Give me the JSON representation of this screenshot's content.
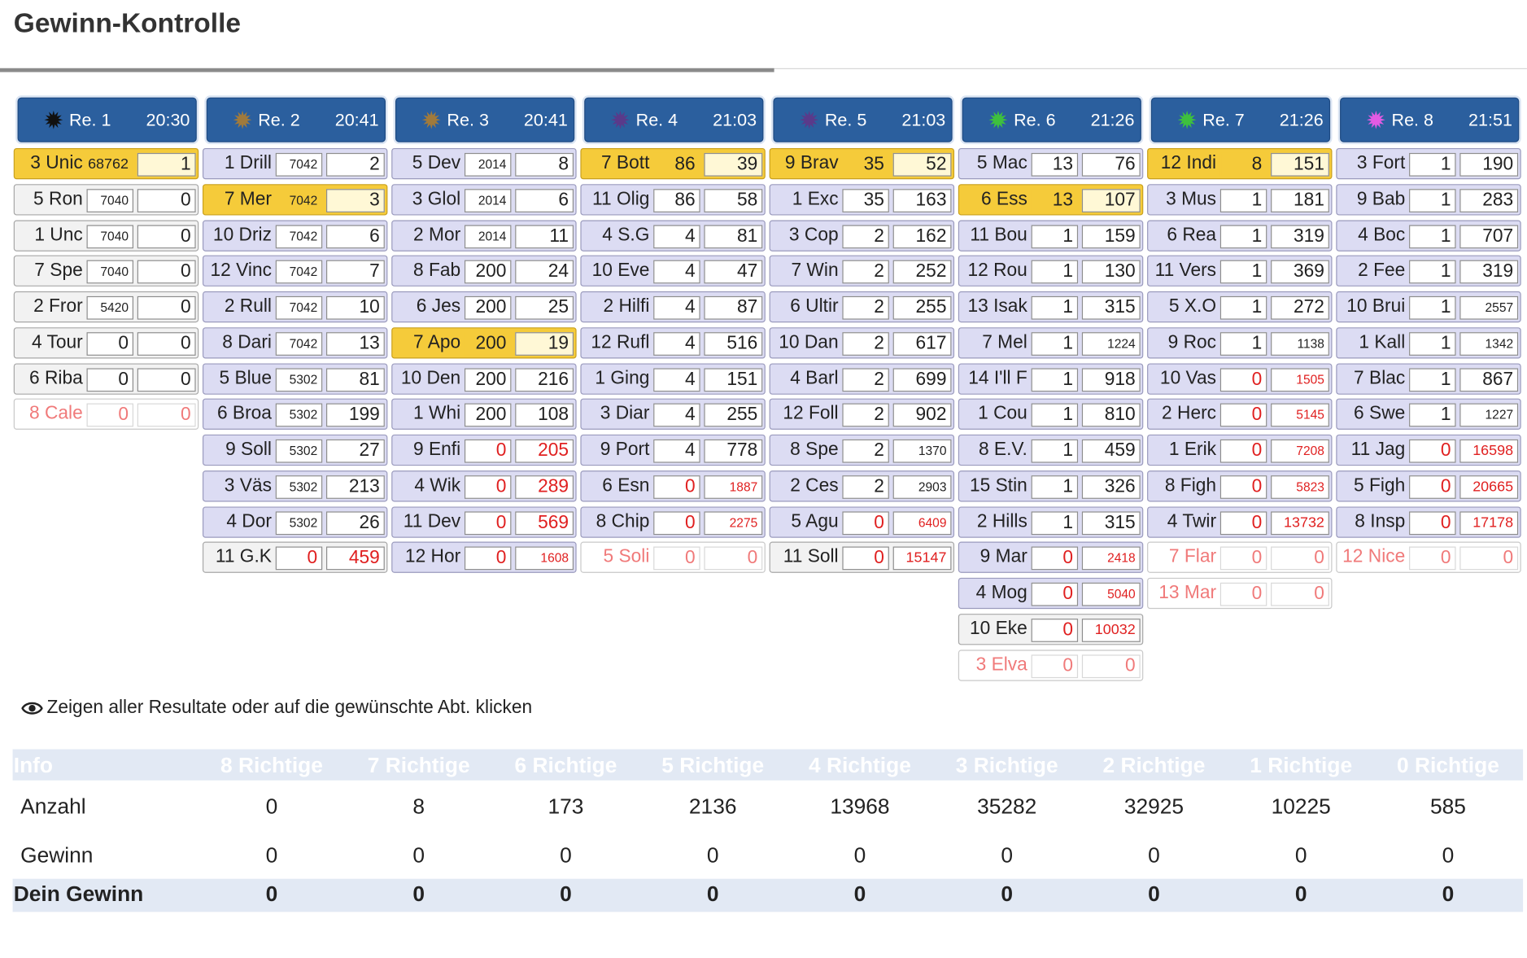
{
  "page": {
    "title": "Gewinn-Kontrolle"
  },
  "races": [
    {
      "name": "Re. 1",
      "time": "20:30",
      "star_color": "#111111",
      "rows": [
        {
          "label": "3 Unic",
          "v1": "68762",
          "v2": "1",
          "state": "sel"
        },
        {
          "label": "5 Ron",
          "v1": "7040",
          "v2": "0",
          "state": "plain"
        },
        {
          "label": "1 Unc",
          "v1": "7040",
          "v2": "0",
          "state": "plain"
        },
        {
          "label": "7 Spe",
          "v1": "7040",
          "v2": "0",
          "state": "plain"
        },
        {
          "label": "2 Fror",
          "v1": "5420",
          "v2": "0",
          "state": "plain"
        },
        {
          "label": "4 Tour",
          "v1": "0",
          "v2": "0",
          "state": "plain"
        },
        {
          "label": "6 Riba",
          "v1": "0",
          "v2": "0",
          "state": "plain"
        },
        {
          "label": "8 Cale",
          "v1": "0",
          "v2": "0",
          "state": "scr"
        }
      ]
    },
    {
      "name": "Re. 2",
      "time": "20:41",
      "star_color": "#a07a3c",
      "rows": [
        {
          "label": "1 Drill",
          "v1": "7042",
          "v2": "2",
          "state": "normal"
        },
        {
          "label": "7 Mer",
          "v1": "7042",
          "v2": "3",
          "state": "sel"
        },
        {
          "label": "10 Driz",
          "v1": "7042",
          "v2": "6",
          "state": "normal"
        },
        {
          "label": "12 Vinc",
          "v1": "7042",
          "v2": "7",
          "state": "normal"
        },
        {
          "label": "2 Rull",
          "v1": "7042",
          "v2": "10",
          "state": "normal"
        },
        {
          "label": "8 Dari",
          "v1": "7042",
          "v2": "13",
          "state": "normal"
        },
        {
          "label": "5 Blue",
          "v1": "5302",
          "v2": "81",
          "state": "normal"
        },
        {
          "label": "6 Broa",
          "v1": "5302",
          "v2": "199",
          "state": "normal"
        },
        {
          "label": "9 Soll",
          "v1": "5302",
          "v2": "27",
          "state": "normal"
        },
        {
          "label": "3 Väs",
          "v1": "5302",
          "v2": "213",
          "state": "normal"
        },
        {
          "label": "4 Dor",
          "v1": "5302",
          "v2": "26",
          "state": "normal"
        },
        {
          "label": "11 G.K",
          "v1": "0",
          "v2": "459",
          "state": "plain",
          "red": true
        }
      ]
    },
    {
      "name": "Re. 3",
      "time": "20:41",
      "star_color": "#a07a3c",
      "rows": [
        {
          "label": "5 Dev",
          "v1": "2014",
          "v2": "8",
          "state": "normal"
        },
        {
          "label": "3 Glol",
          "v1": "2014",
          "v2": "6",
          "state": "normal"
        },
        {
          "label": "2 Mor",
          "v1": "2014",
          "v2": "11",
          "state": "normal"
        },
        {
          "label": "8 Fab",
          "v1": "200",
          "v2": "24",
          "state": "normal"
        },
        {
          "label": "6 Jes",
          "v1": "200",
          "v2": "25",
          "state": "normal"
        },
        {
          "label": "7 Apo",
          "v1": "200",
          "v2": "19",
          "state": "sel"
        },
        {
          "label": "10 Den",
          "v1": "200",
          "v2": "216",
          "state": "normal"
        },
        {
          "label": "1 Whi",
          "v1": "200",
          "v2": "108",
          "state": "normal"
        },
        {
          "label": "9 Enfi",
          "v1": "0",
          "v2": "205",
          "state": "normal",
          "red": true
        },
        {
          "label": "4 Wik",
          "v1": "0",
          "v2": "289",
          "state": "normal",
          "red": true
        },
        {
          "label": "11 Dev",
          "v1": "0",
          "v2": "569",
          "state": "normal",
          "red": true
        },
        {
          "label": "12 Hor",
          "v1": "0",
          "v2": "1608",
          "state": "normal",
          "red": true
        }
      ]
    },
    {
      "name": "Re. 4",
      "time": "21:03",
      "star_color": "#5a3a8a",
      "rows": [
        {
          "label": "7 Bott",
          "v1": "86",
          "v2": "39",
          "state": "sel"
        },
        {
          "label": "11 Olig",
          "v1": "86",
          "v2": "58",
          "state": "normal"
        },
        {
          "label": "4 S.G",
          "v1": "4",
          "v2": "81",
          "state": "normal"
        },
        {
          "label": "10 Eve",
          "v1": "4",
          "v2": "47",
          "state": "normal"
        },
        {
          "label": "2 Hilfi",
          "v1": "4",
          "v2": "87",
          "state": "normal"
        },
        {
          "label": "12 Rufl",
          "v1": "4",
          "v2": "516",
          "state": "normal"
        },
        {
          "label": "1 Ging",
          "v1": "4",
          "v2": "151",
          "state": "normal"
        },
        {
          "label": "3 Diar",
          "v1": "4",
          "v2": "255",
          "state": "normal"
        },
        {
          "label": "9 Port",
          "v1": "4",
          "v2": "778",
          "state": "normal"
        },
        {
          "label": "6 Esn",
          "v1": "0",
          "v2": "1887",
          "state": "normal",
          "red": true
        },
        {
          "label": "8 Chip",
          "v1": "0",
          "v2": "2275",
          "state": "normal",
          "red": true
        },
        {
          "label": "5 Soli",
          "v1": "0",
          "v2": "0",
          "state": "scr"
        }
      ]
    },
    {
      "name": "Re. 5",
      "time": "21:03",
      "star_color": "#5a3a8a",
      "rows": [
        {
          "label": "9 Brav",
          "v1": "35",
          "v2": "52",
          "state": "sel"
        },
        {
          "label": "1 Exc",
          "v1": "35",
          "v2": "163",
          "state": "normal"
        },
        {
          "label": "3 Cop",
          "v1": "2",
          "v2": "162",
          "state": "normal"
        },
        {
          "label": "7 Win",
          "v1": "2",
          "v2": "252",
          "state": "normal"
        },
        {
          "label": "6 Ultir",
          "v1": "2",
          "v2": "255",
          "state": "normal"
        },
        {
          "label": "10 Dan",
          "v1": "2",
          "v2": "617",
          "state": "normal"
        },
        {
          "label": "4 Barl",
          "v1": "2",
          "v2": "699",
          "state": "normal"
        },
        {
          "label": "12 Foll",
          "v1": "2",
          "v2": "902",
          "state": "normal"
        },
        {
          "label": "8 Spe",
          "v1": "2",
          "v2": "1370",
          "state": "normal"
        },
        {
          "label": "2 Ces",
          "v1": "2",
          "v2": "2903",
          "state": "normal"
        },
        {
          "label": "5 Agu",
          "v1": "0",
          "v2": "6409",
          "state": "normal",
          "red": true
        },
        {
          "label": "11 Soll",
          "v1": "0",
          "v2": "15147",
          "state": "plain",
          "red": true
        }
      ]
    },
    {
      "name": "Re. 6",
      "time": "21:26",
      "star_color": "#3ec03e",
      "rows": [
        {
          "label": "5 Mac",
          "v1": "13",
          "v2": "76",
          "state": "normal"
        },
        {
          "label": "6 Ess",
          "v1": "13",
          "v2": "107",
          "state": "sel"
        },
        {
          "label": "11 Bou",
          "v1": "1",
          "v2": "159",
          "state": "normal"
        },
        {
          "label": "12 Rou",
          "v1": "1",
          "v2": "130",
          "state": "normal"
        },
        {
          "label": "13 Isak",
          "v1": "1",
          "v2": "315",
          "state": "normal"
        },
        {
          "label": "7 Mel",
          "v1": "1",
          "v2": "1224",
          "state": "normal"
        },
        {
          "label": "14 I'll F",
          "v1": "1",
          "v2": "918",
          "state": "normal"
        },
        {
          "label": "1 Cou",
          "v1": "1",
          "v2": "810",
          "state": "normal"
        },
        {
          "label": "8 E.V.",
          "v1": "1",
          "v2": "459",
          "state": "normal"
        },
        {
          "label": "15 Stin",
          "v1": "1",
          "v2": "326",
          "state": "normal"
        },
        {
          "label": "2 Hills",
          "v1": "1",
          "v2": "315",
          "state": "normal"
        },
        {
          "label": "9 Mar",
          "v1": "0",
          "v2": "2418",
          "state": "normal",
          "red": true
        },
        {
          "label": "4 Mog",
          "v1": "0",
          "v2": "5040",
          "state": "normal",
          "red": true
        },
        {
          "label": "10 Eke",
          "v1": "0",
          "v2": "10032",
          "state": "plain",
          "red": true
        },
        {
          "label": "3 Elva",
          "v1": "0",
          "v2": "0",
          "state": "scr"
        }
      ]
    },
    {
      "name": "Re. 7",
      "time": "21:26",
      "star_color": "#3ec03e",
      "rows": [
        {
          "label": "12 Indi",
          "v1": "8",
          "v2": "151",
          "state": "sel"
        },
        {
          "label": "3 Mus",
          "v1": "1",
          "v2": "181",
          "state": "normal"
        },
        {
          "label": "6 Rea",
          "v1": "1",
          "v2": "319",
          "state": "normal"
        },
        {
          "label": "11 Vers",
          "v1": "1",
          "v2": "369",
          "state": "normal"
        },
        {
          "label": "5 X.O",
          "v1": "1",
          "v2": "272",
          "state": "normal"
        },
        {
          "label": "9 Roc",
          "v1": "1",
          "v2": "1138",
          "state": "normal"
        },
        {
          "label": "10 Vas",
          "v1": "0",
          "v2": "1505",
          "state": "normal",
          "red": true
        },
        {
          "label": "2 Herc",
          "v1": "0",
          "v2": "5145",
          "state": "normal",
          "red": true
        },
        {
          "label": "1 Erik",
          "v1": "0",
          "v2": "7208",
          "state": "normal",
          "red": true
        },
        {
          "label": "8 Figh",
          "v1": "0",
          "v2": "5823",
          "state": "normal",
          "red": true
        },
        {
          "label": "4 Twir",
          "v1": "0",
          "v2": "13732",
          "state": "normal",
          "red": true
        },
        {
          "label": "7 Flar",
          "v1": "0",
          "v2": "0",
          "state": "scr"
        },
        {
          "label": "13 Mar",
          "v1": "0",
          "v2": "0",
          "state": "scr"
        }
      ]
    },
    {
      "name": "Re. 8",
      "time": "21:51",
      "star_color": "#e35be3",
      "rows": [
        {
          "label": "3 Fort",
          "v1": "1",
          "v2": "190",
          "state": "normal"
        },
        {
          "label": "9 Bab",
          "v1": "1",
          "v2": "283",
          "state": "normal"
        },
        {
          "label": "4 Boc",
          "v1": "1",
          "v2": "707",
          "state": "normal"
        },
        {
          "label": "2 Fee",
          "v1": "1",
          "v2": "319",
          "state": "normal"
        },
        {
          "label": "10 Brui",
          "v1": "1",
          "v2": "2557",
          "state": "normal"
        },
        {
          "label": "1 Kall",
          "v1": "1",
          "v2": "1342",
          "state": "normal"
        },
        {
          "label": "7 Blac",
          "v1": "1",
          "v2": "867",
          "state": "normal"
        },
        {
          "label": "6 Swe",
          "v1": "1",
          "v2": "1227",
          "state": "normal"
        },
        {
          "label": "11 Jag",
          "v1": "0",
          "v2": "16598",
          "state": "normal",
          "red": true
        },
        {
          "label": "5 Figh",
          "v1": "0",
          "v2": "20665",
          "state": "normal",
          "red": true
        },
        {
          "label": "8 Insp",
          "v1": "0",
          "v2": "17178",
          "state": "normal",
          "red": true
        },
        {
          "label": "12 Nice",
          "v1": "0",
          "v2": "0",
          "state": "scr"
        }
      ]
    }
  ],
  "info_text": "Zeigen aller Resultate oder auf die gewünschte Abt. klicken",
  "results": {
    "headers": [
      "Info",
      "8 Richtige",
      "7 Richtige",
      "6 Richtige",
      "5 Richtige",
      "4 Richtige",
      "3 Richtige",
      "2 Richtige",
      "1 Richtige",
      "0 Richtige"
    ],
    "rows": [
      {
        "label": "Anzahl",
        "values": [
          "0",
          "8",
          "173",
          "2136",
          "13968",
          "35282",
          "32925",
          "10225",
          "585"
        ]
      },
      {
        "label": "Gewinn",
        "values": [
          "0",
          "0",
          "0",
          "0",
          "0",
          "0",
          "0",
          "0",
          "0"
        ]
      },
      {
        "label": "Dein Gewinn",
        "values": [
          "0",
          "0",
          "0",
          "0",
          "0",
          "0",
          "0",
          "0",
          "0"
        ],
        "total": true
      }
    ]
  },
  "colors": {
    "header_blue": "#2b5f9e",
    "selected_yellow": "#f5cb3a",
    "row_lavender": "#dcdcf3",
    "negative_red": "#e02020"
  }
}
